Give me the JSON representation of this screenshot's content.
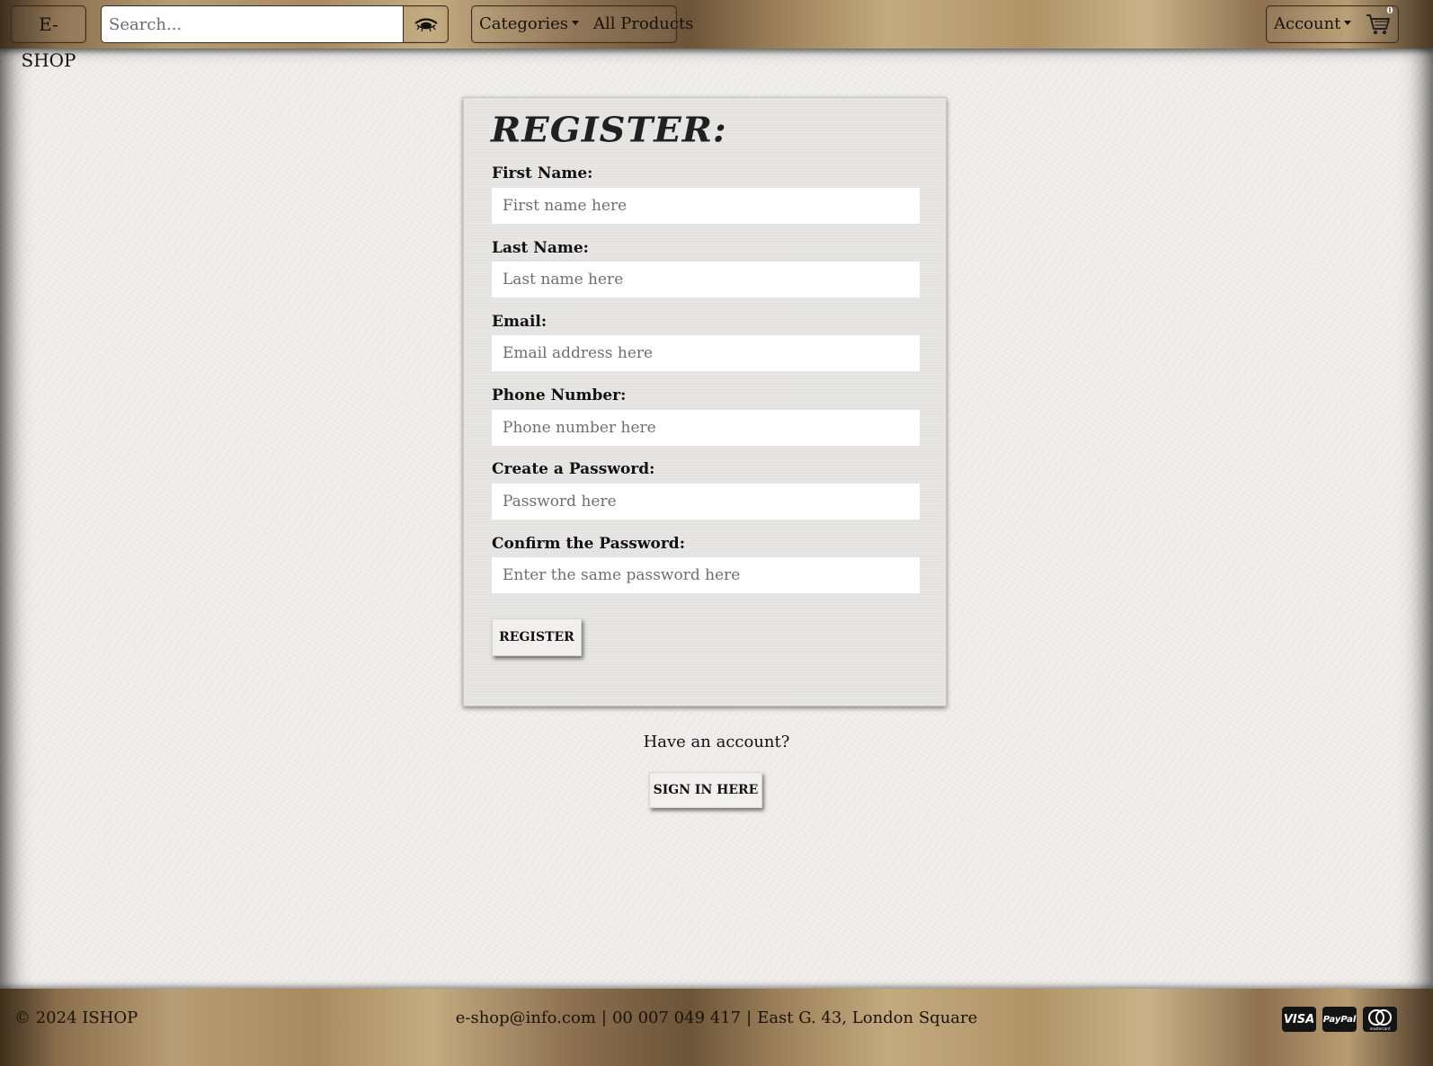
{
  "navbar": {
    "brand": "E-SHOP",
    "search": {
      "placeholder": "Search...",
      "value": "",
      "button_icon": "eye-icon"
    },
    "menu": {
      "categories": "Categories",
      "all_products": "All Products"
    },
    "account": "Account",
    "cart": {
      "icon": "cart-icon",
      "count": "0"
    }
  },
  "form": {
    "title": "REGISTER:",
    "fields": [
      {
        "label": "First Name:",
        "placeholder": "First name here"
      },
      {
        "label": "Last Name:",
        "placeholder": "Last name here"
      },
      {
        "label": "Email:",
        "placeholder": "Email address here"
      },
      {
        "label": "Phone Number:",
        "placeholder": "Phone number here"
      },
      {
        "label": "Create a Password:",
        "placeholder": "Password here"
      },
      {
        "label": "Confirm the Password:",
        "placeholder": "Enter the same password here"
      }
    ],
    "submit": "REGISTER"
  },
  "signin": {
    "prompt": "Have an account?",
    "button": "SIGN IN HERE"
  },
  "footer": {
    "copyright": "© 2024 ISHOP",
    "email": "e-shop@info.com",
    "phone": "00 007 049 417",
    "address": "East G. 43, London Square",
    "separator": "|",
    "payments": [
      "VISA",
      "PayPal",
      "mastercard"
    ]
  },
  "colors": {
    "brass_light": "#c4ac82",
    "brass_dark": "#3e2f1d",
    "background": "#f0efed",
    "card": "#e6e5e3"
  }
}
